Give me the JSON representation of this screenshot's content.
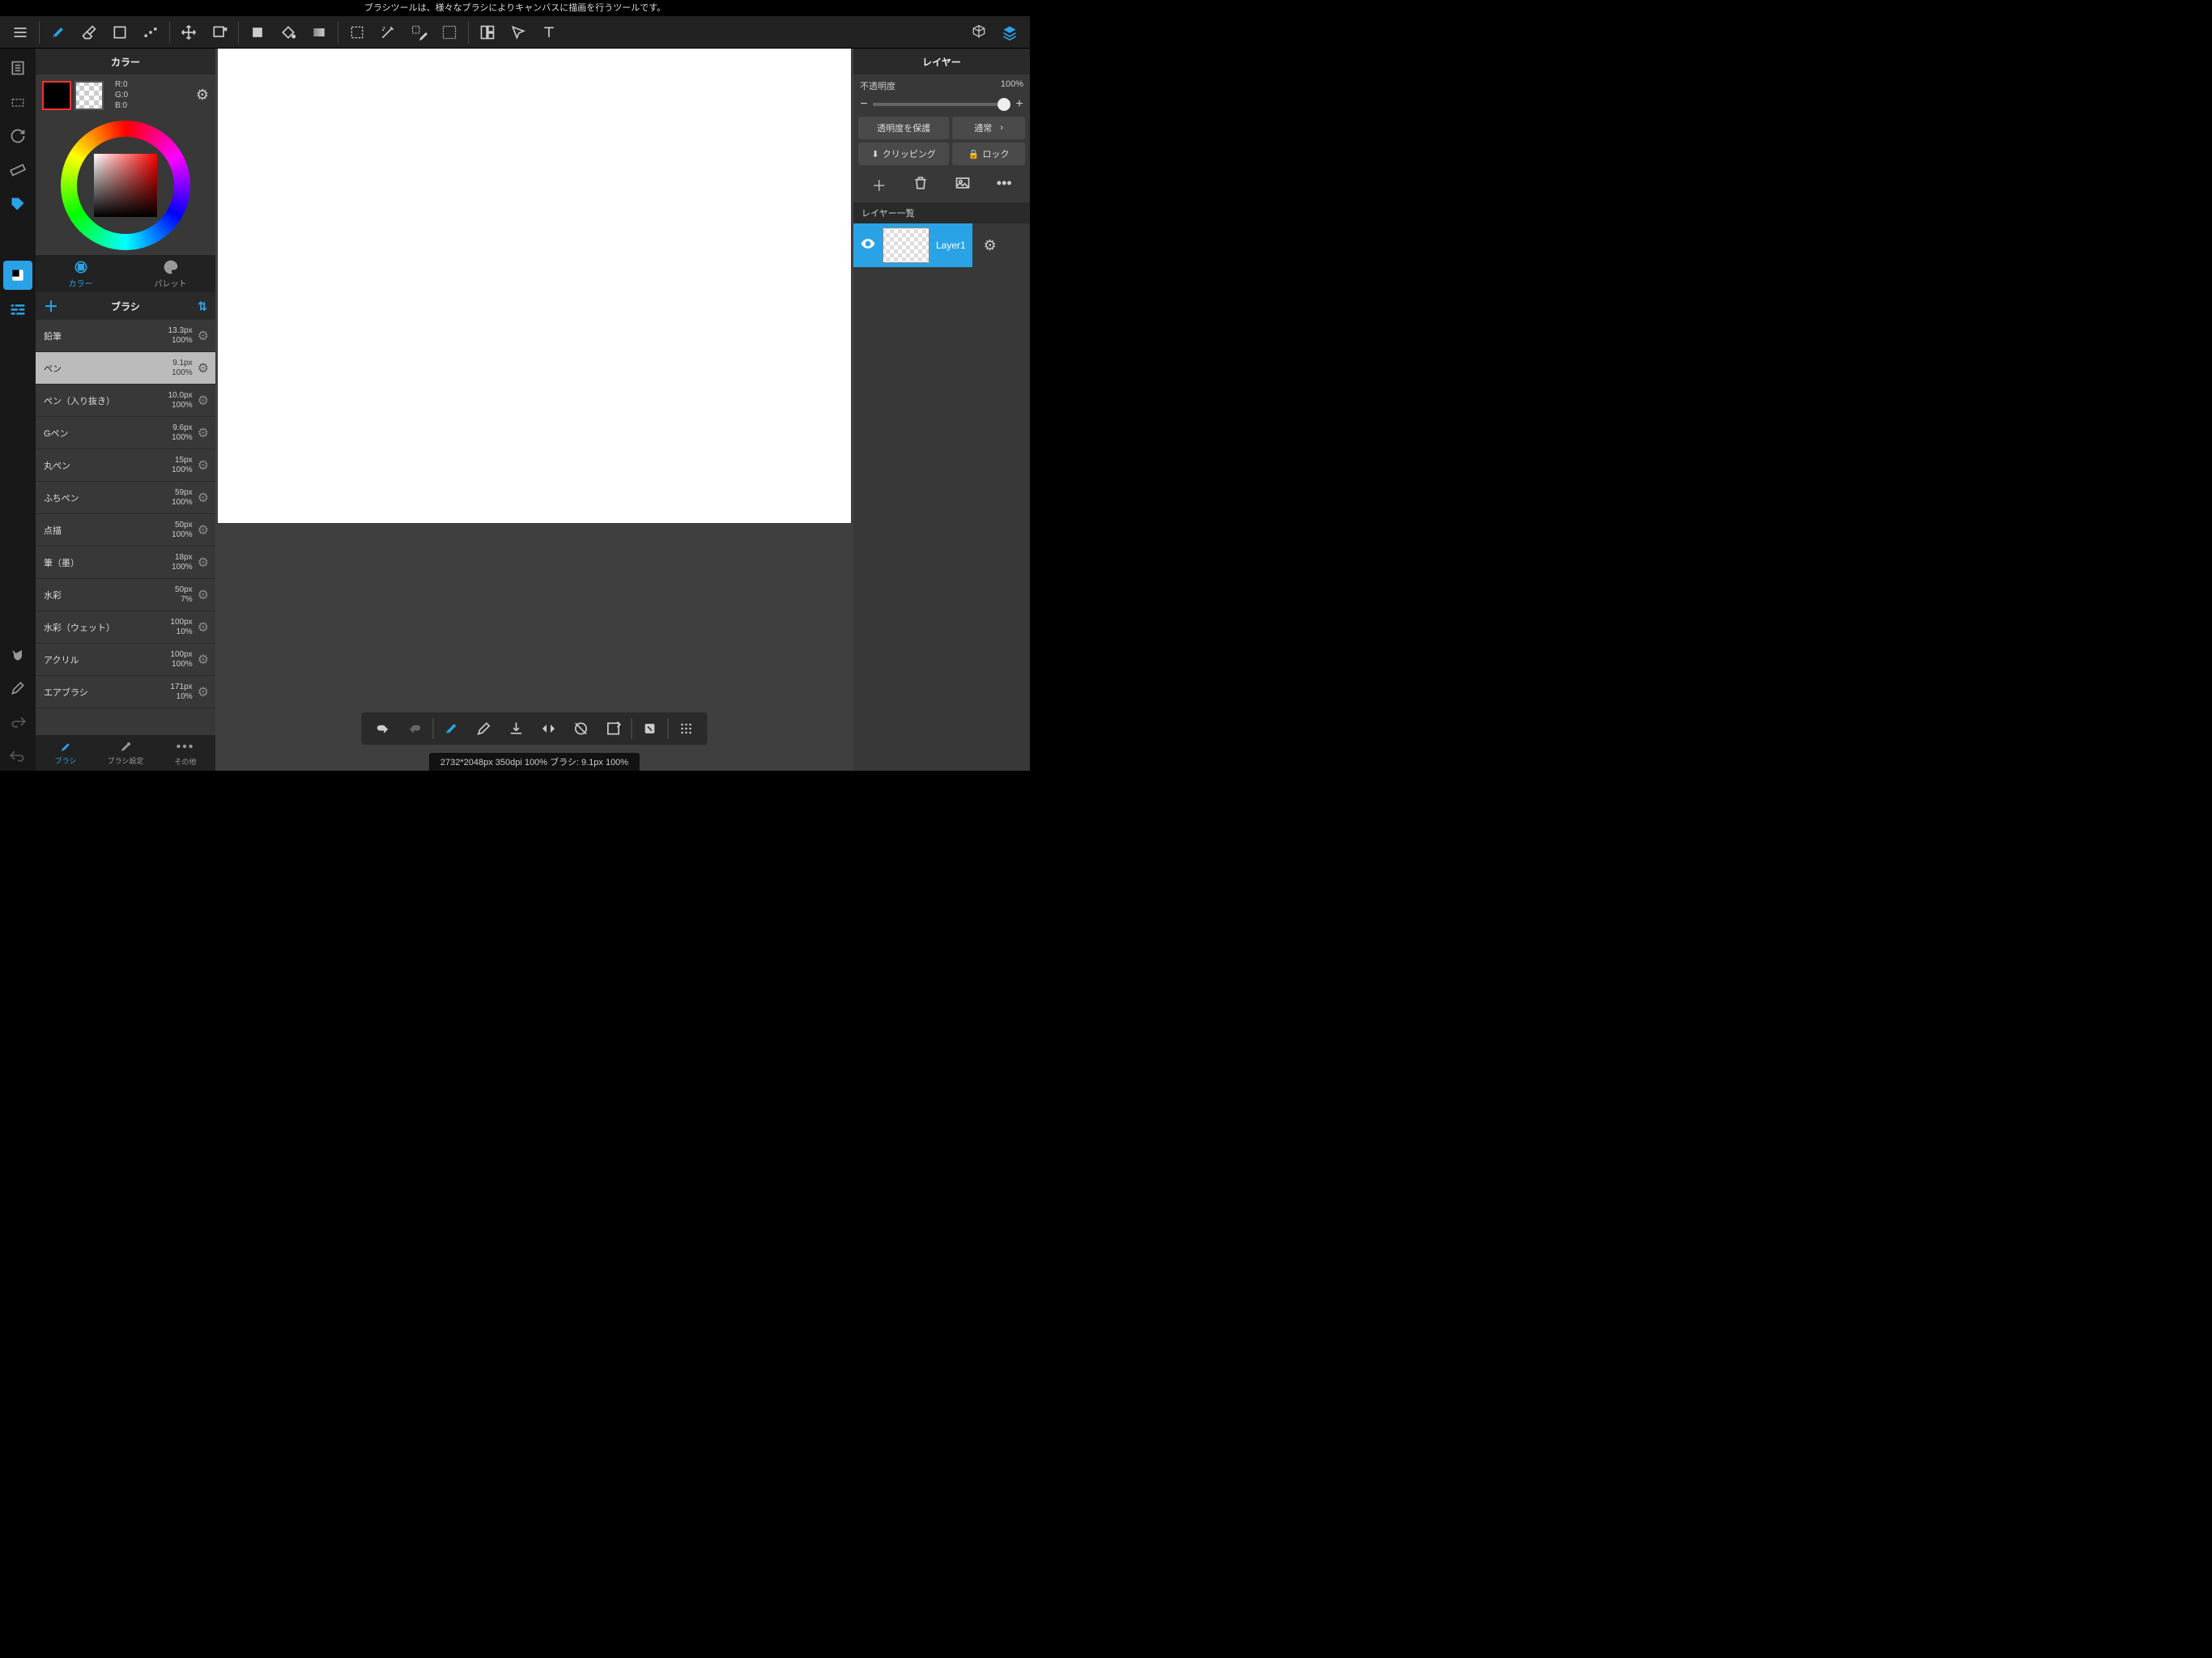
{
  "hint": "ブラシツールは、様々なブラシによりキャンバスに描画を行うツールです。",
  "color_panel": {
    "title": "カラー",
    "rgb": {
      "r": "R:0",
      "g": "G:0",
      "b": "B:0"
    },
    "tab_color": "カラー",
    "tab_palette": "パレット"
  },
  "brush_panel": {
    "title": "ブラシ",
    "tab_brush": "ブラシ",
    "tab_settings": "ブラシ設定",
    "tab_other": "その他",
    "brushes": [
      {
        "name": "鉛筆",
        "size": "13.3px",
        "opacity": "100%",
        "selected": false
      },
      {
        "name": "ペン",
        "size": "9.1px",
        "opacity": "100%",
        "selected": true
      },
      {
        "name": "ペン（入り抜き）",
        "size": "10.0px",
        "opacity": "100%",
        "selected": false
      },
      {
        "name": "Gペン",
        "size": "9.6px",
        "opacity": "100%",
        "selected": false
      },
      {
        "name": "丸ペン",
        "size": "15px",
        "opacity": "100%",
        "selected": false
      },
      {
        "name": "ふちペン",
        "size": "59px",
        "opacity": "100%",
        "selected": false
      },
      {
        "name": "点描",
        "size": "50px",
        "opacity": "100%",
        "selected": false
      },
      {
        "name": "筆（墨）",
        "size": "18px",
        "opacity": "100%",
        "selected": false
      },
      {
        "name": "水彩",
        "size": "50px",
        "opacity": "7%",
        "selected": false
      },
      {
        "name": "水彩（ウェット）",
        "size": "100px",
        "opacity": "10%",
        "selected": false
      },
      {
        "name": "アクリル",
        "size": "100px",
        "opacity": "100%",
        "selected": false
      },
      {
        "name": "エアブラシ",
        "size": "171px",
        "opacity": "10%",
        "selected": false
      }
    ]
  },
  "layer_panel": {
    "title": "レイヤー",
    "opacity_label": "不透明度",
    "opacity_value": "100%",
    "protect": "透明度を保護",
    "blend": "通常",
    "clipping": "クリッピング",
    "lock": "ロック",
    "list_title": "レイヤー一覧",
    "layers": [
      {
        "name": "Layer1"
      }
    ]
  },
  "status": "2732*2048px 350dpi 100% ブラシ: 9.1px 100%"
}
